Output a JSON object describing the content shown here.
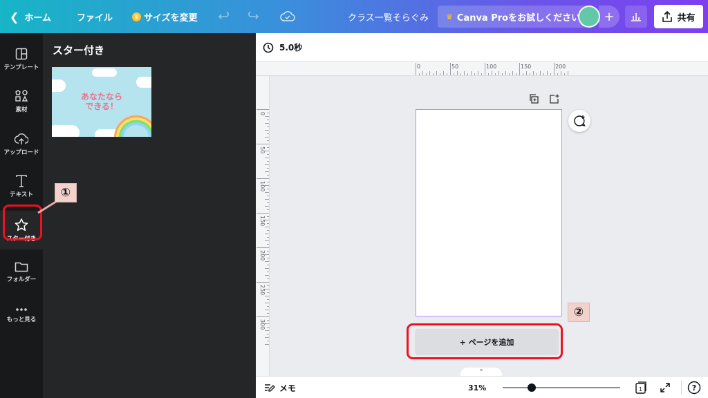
{
  "header": {
    "home_label": "ホーム",
    "file_label": "ファイル",
    "resize_label": "サイズを変更",
    "title": "クラス一覧そらぐみ",
    "pro_label": "Canva Proをお試しください",
    "plus_label": "+",
    "share_label": "共有",
    "gradient_colors": [
      "#17b5c6",
      "#3a8fdc",
      "#6a55e8",
      "#7d3ff0"
    ]
  },
  "rail": {
    "items": [
      {
        "label": "テンプレート",
        "icon": "template-icon"
      },
      {
        "label": "素材",
        "icon": "elements-icon"
      },
      {
        "label": "アップロード",
        "icon": "upload-icon"
      },
      {
        "label": "テキスト",
        "icon": "text-icon"
      },
      {
        "label": "スター付き",
        "icon": "star-icon"
      },
      {
        "label": "フォルダー",
        "icon": "folder-icon"
      },
      {
        "label": "もっと見る",
        "icon": "more-icon"
      }
    ],
    "active": "スター付き"
  },
  "panel": {
    "title": "スター付き",
    "thumbnail_lines": [
      "あなたなら",
      "できる！"
    ]
  },
  "annotations": {
    "marker1": "①",
    "marker2": "②",
    "highlight_color": "#ee1122"
  },
  "editor": {
    "duration": "5.0秒",
    "ruler_top": [
      "0",
      "50",
      "100",
      "150",
      "200"
    ],
    "ruler_left": [
      "0",
      "50",
      "100",
      "150",
      "200",
      "250",
      "300"
    ],
    "add_page_label": "+ ページを追加",
    "notch_label": "⌃"
  },
  "footer": {
    "memo_label": "メモ",
    "zoom_label": "31%",
    "zoom_value": 0.31,
    "page_count": "1",
    "help_label": "?"
  }
}
